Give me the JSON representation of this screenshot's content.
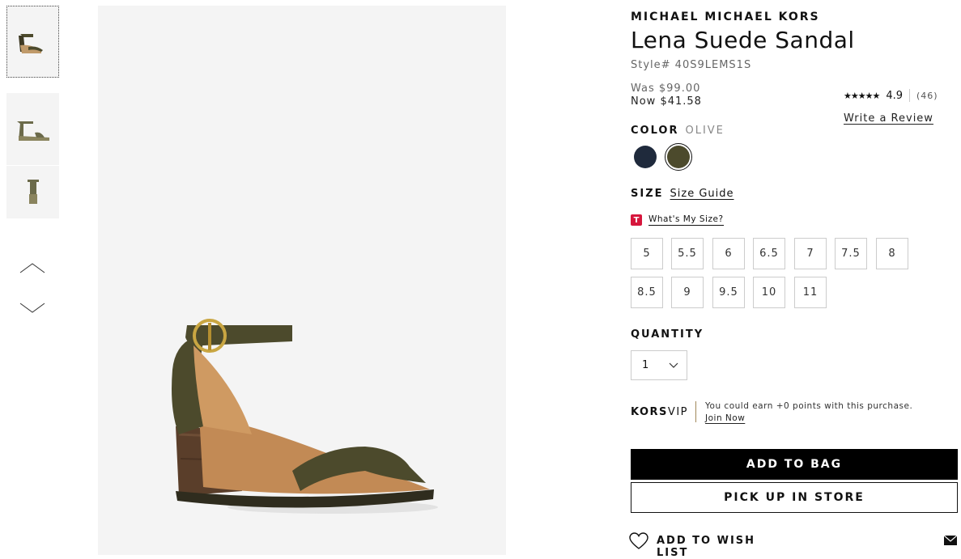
{
  "thumbnails": [
    {
      "alt": "sandal-front-view",
      "active": true
    },
    {
      "alt": "sandal-side-view",
      "active": false
    },
    {
      "alt": "sandal-back-view",
      "active": false
    }
  ],
  "product": {
    "brand": "MICHAEL MICHAEL KORS",
    "name": "Lena Suede Sandal",
    "style": "Style# 40S9LEMS1S",
    "was_price": "Was $99.00",
    "now_price": "Now $41.58",
    "rating_value": "4.9",
    "rating_stars": "★★★★★",
    "review_count": "(46)",
    "write_review": "Write a Review"
  },
  "color": {
    "label": "COLOR",
    "selected": "OLIVE",
    "swatches": [
      {
        "name": "navy",
        "hex": "#1f2a3c"
      },
      {
        "name": "olive",
        "hex": "#4c4a2c"
      }
    ]
  },
  "size": {
    "label": "SIZE",
    "guide": "Size Guide",
    "true_fit_logo": "T",
    "true_fit": "What's My Size?",
    "options": [
      "5",
      "5.5",
      "6",
      "6.5",
      "7",
      "7.5",
      "8",
      "8.5",
      "9",
      "9.5",
      "10",
      "11"
    ]
  },
  "quantity": {
    "label": "QUANTITY",
    "value": "1"
  },
  "vip": {
    "brand_bold": "KORS",
    "brand_light": "VIP",
    "text": "You could earn +0 points with this purchase.",
    "join": "Join Now"
  },
  "actions": {
    "add_to_bag": "ADD TO BAG",
    "pick_up": "PICK UP IN STORE",
    "wishlist": "ADD TO WISH LIST"
  },
  "colors": {
    "accent": "#000000",
    "olive": "#4c4a2c",
    "true_fit_red": "#d6163c"
  }
}
